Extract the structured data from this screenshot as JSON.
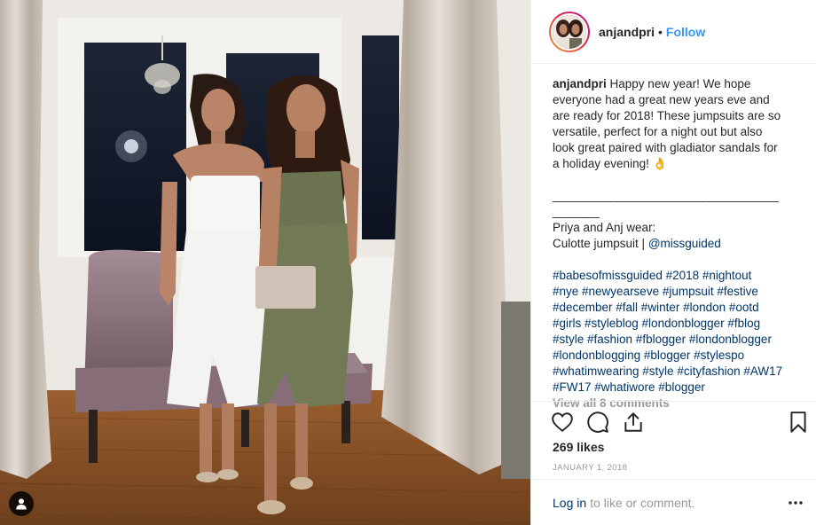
{
  "post": {
    "username": "anjandpri",
    "dot": "•",
    "follow_label": "Follow",
    "caption_lines": [
      "Happy new year! We hope",
      "everyone had a great new years eve and",
      "are ready for 2018! These jumpsuits are so",
      "versatile, perfect for a night out but also",
      "look great paired with gladiator sandals for",
      "a holiday evening! 👌"
    ],
    "separator_line_1": "_______________________________________",
    "separator_line_2": "________",
    "wear_line": "Priya and Anj wear:",
    "outfit_prefix": "Culotte jumpsuit | ",
    "outfit_mention": "@missguided",
    "hashtag_lines": [
      "#babesofmissguided #2018 #nightout",
      "#nye #newyearseve #jumpsuit #festive",
      "#december #fall #winter #london #ootd",
      "#girls #styleblog #londonblogger #fblog",
      "#style #fashion #fblogger #londonblogger",
      "#londonblogging #blogger #stylespo",
      "#whatimwearing #style #cityfashion #AW17",
      "#FW17 #whatiwore #blogger"
    ],
    "view_all": "View all 8 comments",
    "likes": "269 likes",
    "date": "JANUARY 1, 2018",
    "login_label": "Log in",
    "login_rest": "to like or comment.",
    "more_icon": "ellipsis-icon"
  },
  "icons": {
    "like": "heart-icon",
    "comment": "comment-icon",
    "share": "share-icon",
    "save": "bookmark-icon",
    "tag": "user-tag-icon"
  },
  "colors": {
    "link": "#3897f0",
    "hashtag": "#003569",
    "muted": "#999999",
    "text": "#262626"
  }
}
